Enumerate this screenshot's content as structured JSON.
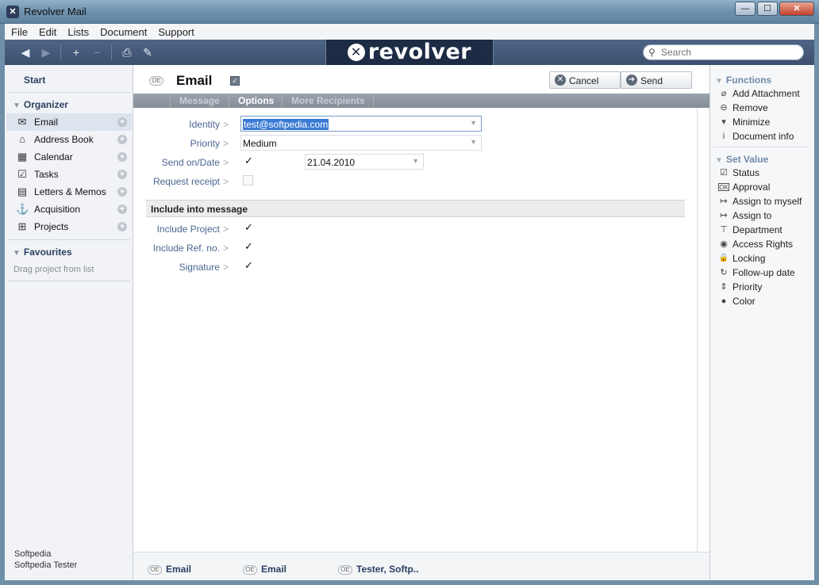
{
  "window": {
    "title": "Revolver Mail",
    "app_icon": "app-icon"
  },
  "window_controls": {
    "minimize": "—",
    "maximize": "☐",
    "close": "✕"
  },
  "menu": [
    "File",
    "Edit",
    "Lists",
    "Document",
    "Support"
  ],
  "toolbar": {
    "back": "◀",
    "forward": "▶",
    "add": "+",
    "remove": "−",
    "print": "⎙",
    "note": "✎",
    "logo_text": "revolver",
    "search_placeholder": "Search"
  },
  "sidebar": {
    "start": "Start",
    "organizer_title": "Organizer",
    "items": [
      {
        "label": "Email",
        "icon": "envelope-icon",
        "glyph": "✉",
        "active": true
      },
      {
        "label": "Address Book",
        "icon": "house-icon",
        "glyph": "⌂"
      },
      {
        "label": "Calendar",
        "icon": "calendar-icon",
        "glyph": "▦"
      },
      {
        "label": "Tasks",
        "icon": "check-icon",
        "glyph": "☑"
      },
      {
        "label": "Letters & Memos",
        "icon": "document-icon",
        "glyph": "▤"
      },
      {
        "label": "Acquisition",
        "icon": "anchor-icon",
        "glyph": "⚓"
      },
      {
        "label": "Projects",
        "icon": "hierarchy-icon",
        "glyph": "⊞"
      }
    ],
    "favourites_title": "Favourites",
    "favourites_hint": "Drag project from list",
    "user_line1": "Softpedia",
    "user_line2": "Softpedia Tester"
  },
  "document": {
    "badge": "OE",
    "title": "Email",
    "cancel_label": "Cancel",
    "send_label": "Send",
    "tabs": [
      "Message",
      "Options",
      "More Recipients"
    ],
    "active_tab": "Options",
    "fields": {
      "identity_label": "Identity",
      "identity_value": "test@softpedia.com",
      "priority_label": "Priority",
      "priority_value": "Medium",
      "send_on_label": "Send on/Date",
      "send_on_checked": true,
      "date_value": "21.04.2010",
      "receipt_label": "Request receipt",
      "receipt_checked": false
    },
    "include_section": "Include into message",
    "include": {
      "project_label": "Include Project",
      "refno_label": "Include Ref. no.",
      "signature_label": "Signature"
    },
    "gt": ">",
    "check": "✓"
  },
  "footer": {
    "items": [
      {
        "badge": "OE",
        "label": "Email"
      },
      {
        "badge": "OE",
        "label": "Email"
      },
      {
        "badge": "OE",
        "label": "Tester, Softp.."
      }
    ]
  },
  "right_panel": {
    "functions_title": "Functions",
    "functions": [
      {
        "label": "Add Attachment",
        "icon": "paperclip-icon",
        "glyph": "⌀"
      },
      {
        "label": "Remove",
        "icon": "remove-icon",
        "glyph": "⊖"
      },
      {
        "label": "Minimize",
        "icon": "minimize-icon",
        "glyph": "▾"
      },
      {
        "label": "Document info",
        "icon": "info-icon",
        "glyph": "i"
      }
    ],
    "setvalue_title": "Set Value",
    "set_values": [
      {
        "label": "Status",
        "icon": "status-icon",
        "glyph": "☑"
      },
      {
        "label": "Approval",
        "icon": "ok-icon",
        "glyph": "OK"
      },
      {
        "label": "Assign to myself",
        "icon": "assign-self-icon",
        "glyph": "↦"
      },
      {
        "label": "Assign to",
        "icon": "assign-icon",
        "glyph": "↦"
      },
      {
        "label": "Department",
        "icon": "department-icon",
        "glyph": "⊤"
      },
      {
        "label": "Access Rights",
        "icon": "eye-icon",
        "glyph": "◉"
      },
      {
        "label": "Locking",
        "icon": "lock-icon",
        "glyph": "🔒"
      },
      {
        "label": "Follow-up date",
        "icon": "refresh-icon",
        "glyph": "↻"
      },
      {
        "label": "Priority",
        "icon": "priority-icon",
        "glyph": "⇕"
      },
      {
        "label": "Color",
        "icon": "drop-icon",
        "glyph": "●"
      }
    ]
  }
}
